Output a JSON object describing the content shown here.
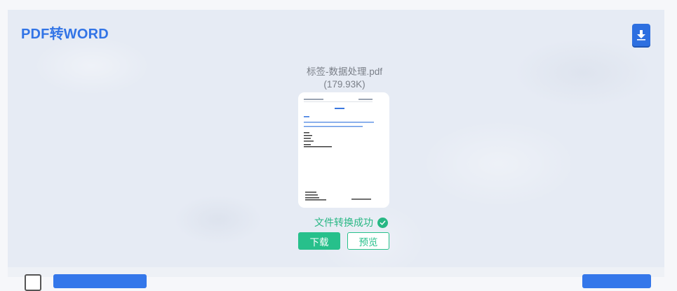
{
  "app": {
    "title": "PDF转WORD"
  },
  "file": {
    "name": "标签-数据处理.pdf",
    "size": "(179.93K)",
    "status": "文件转换成功"
  },
  "actions": {
    "download_label": "下载",
    "preview_label": "预览"
  },
  "icons": {
    "download_all": "download-icon",
    "status": "check-circle-icon"
  },
  "colors": {
    "accent": "#3274e6",
    "success": "#27c08b",
    "panel_bg": "#e6ebf4"
  }
}
